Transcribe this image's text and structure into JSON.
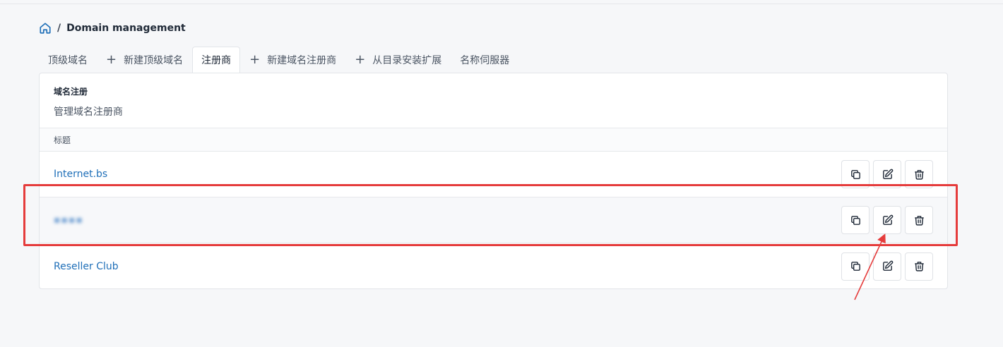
{
  "breadcrumb": {
    "home_icon": "home-icon",
    "separator": "/",
    "title": "Domain management"
  },
  "tabs": [
    {
      "label": "顶级域名",
      "icon": null,
      "active": false
    },
    {
      "label": "新建顶级域名",
      "icon": "plus-icon",
      "active": false
    },
    {
      "label": "注册商",
      "icon": null,
      "active": true
    },
    {
      "label": "新建域名注册商",
      "icon": "plus-icon",
      "active": false
    },
    {
      "label": "从目录安装扩展",
      "icon": "plus-icon",
      "active": false
    },
    {
      "label": "名称伺服器",
      "icon": null,
      "active": false
    }
  ],
  "card": {
    "title": "域名注册",
    "subtitle": "管理域名注册商",
    "column_header": "标题",
    "rows": [
      {
        "name": "Internet.bs",
        "blurred": false,
        "actions": [
          "copy-icon",
          "edit-icon",
          "trash-icon"
        ]
      },
      {
        "name": "▪▪▪▪",
        "blurred": true,
        "actions": [
          "copy-icon",
          "edit-icon",
          "trash-icon"
        ]
      },
      {
        "name": "Reseller Club",
        "blurred": false,
        "actions": [
          "copy-icon",
          "edit-icon",
          "trash-icon"
        ]
      }
    ]
  },
  "annotation": {
    "highlight_color": "#e53c3c",
    "highlighted_row": 1,
    "arrow_target": "edit-button"
  },
  "colors": {
    "link": "#1f6fb8",
    "brand": "#1f6fb8",
    "annotation": "#e53c3c"
  }
}
